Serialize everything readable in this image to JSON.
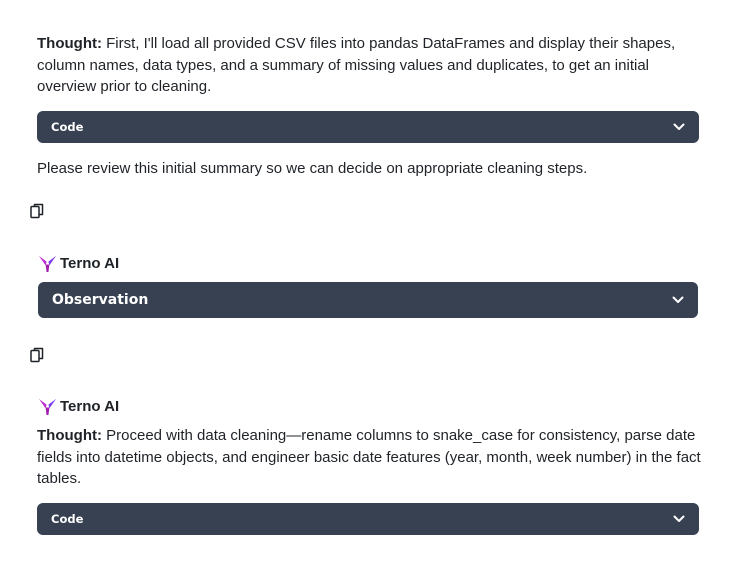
{
  "messages": [
    {
      "thought_label": "Thought:",
      "thought_text": " First, I'll load all provided CSV files into pandas DataFrames and display their shapes, column names, data types, and a summary of missing values and duplicates, to get an initial overview prior to cleaning.",
      "code_label": "Code",
      "followup_text": "Please review this initial summary so we can decide on appropriate cleaning steps."
    },
    {
      "author": "Terno AI",
      "observation_label": "Observation"
    },
    {
      "author": "Terno AI",
      "thought_label": "Thought:",
      "thought_text": " Proceed with data cleaning—rename columns to snake_case for consistency, parse date fields into datetime objects, and engineer basic date features (year, month, week number) in the fact tables.",
      "code_label": "Code"
    }
  ],
  "icons": {
    "copy": "copy-icon",
    "chevron": "chevron-down-icon",
    "logo": "terno-ai-logo"
  },
  "colors": {
    "bar_background": "#374151",
    "bar_text": "#ffffff",
    "logo_primary": "#c026d3",
    "logo_secondary": "#7c3aed"
  }
}
